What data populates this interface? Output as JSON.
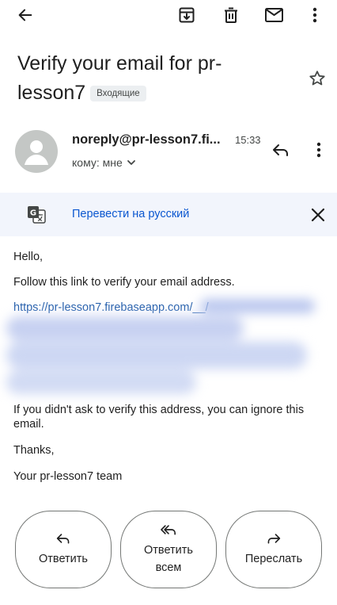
{
  "toolbar": {
    "back_icon": "arrow-back-icon",
    "archive_icon": "archive-icon",
    "delete_icon": "trash-icon",
    "mark_unread_icon": "mail-icon",
    "more_icon": "more-vertical-icon"
  },
  "email": {
    "subject": "Verify your email for pr-lesson7",
    "label": "Входящие",
    "sender": "noreply@pr-lesson7.fi...",
    "time": "15:33",
    "recipient": "кому: мне"
  },
  "translate": {
    "label": "Перевести на русский"
  },
  "body": {
    "greeting": "Hello,",
    "instruction": "Follow this link to verify your email address.",
    "link": "https://pr-lesson7.firebaseapp.com/__/",
    "ignore_note": "If you didn't ask to verify this address, you can ignore this email.",
    "thanks": "Thanks,",
    "signature": "Your pr-lesson7 team"
  },
  "actions": {
    "reply": "Ответить",
    "reply_all": "Ответить всем",
    "forward": "Переслать"
  },
  "colors": {
    "accent": "#0b57d0",
    "translate_bg": "#f2f5fc",
    "link": "#2962ad"
  }
}
